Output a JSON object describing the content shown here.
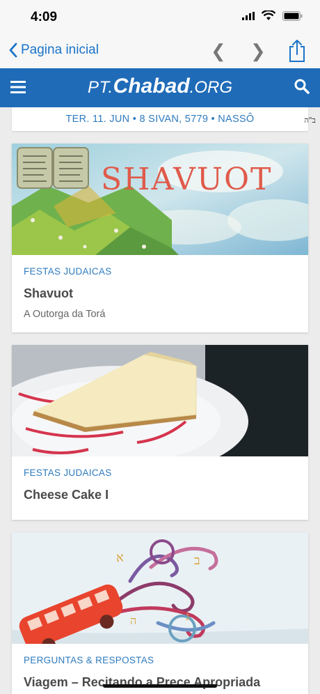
{
  "status": {
    "time": "4:09"
  },
  "nav": {
    "back_label": "Pagina inicial",
    "prev_glyph": "❮",
    "next_glyph": "❯"
  },
  "header": {
    "logo_pt": "PT.",
    "logo_chabad": "Chabad",
    "logo_org": ".ORG"
  },
  "date_bar": {
    "text": "TER. 11. JUN • 8 SIVAN, 5779 • NASSÔ",
    "bsd": "ב\"ה"
  },
  "cards": [
    {
      "image_text": "SHAVUOT",
      "category": "FESTAS JUDAICAS",
      "title": "Shavuot",
      "subtitle": "A Outorga da Torá"
    },
    {
      "category": "FESTAS JUDAICAS",
      "title": "Cheese Cake I"
    },
    {
      "category": "PERGUNTAS & RESPOSTAS",
      "title": "Viagem – Recitando a Prece Apropriada"
    }
  ],
  "colors": {
    "brand": "#1f6bb8",
    "link": "#2e7bbf",
    "ios_blue": "#1a73c9"
  }
}
